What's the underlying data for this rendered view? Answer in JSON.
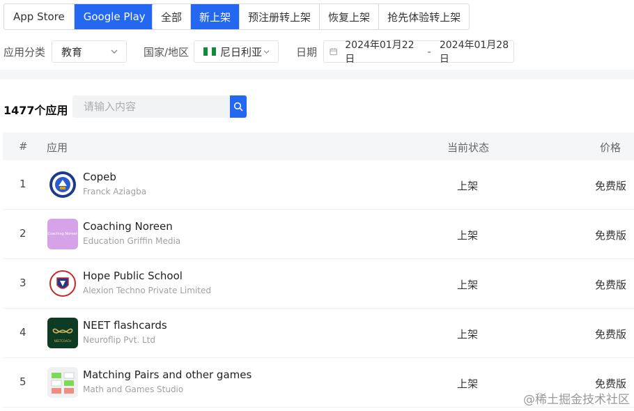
{
  "store_tabs": [
    {
      "label": "App Store",
      "active": false
    },
    {
      "label": "Google Play",
      "active": true
    }
  ],
  "type_tabs": [
    {
      "label": "全部",
      "active": false
    },
    {
      "label": "新上架",
      "active": true
    },
    {
      "label": "预注册转上架",
      "active": false
    },
    {
      "label": "恢复上架",
      "active": false
    },
    {
      "label": "抢先体验转上架",
      "active": false
    }
  ],
  "filters": {
    "category_label": "应用分类",
    "category_value": "教育",
    "country_label": "国家/地区",
    "country_value": "尼日利亚",
    "date_label": "日期",
    "date_start": "2024年01月22日",
    "date_sep": "-",
    "date_end": "2024年01月28日"
  },
  "summary": {
    "count": "1477个应用",
    "search_placeholder": "请输入内容"
  },
  "table": {
    "headers": {
      "index": "#",
      "app": "应用",
      "status": "当前状态",
      "price": "价格"
    },
    "rows": [
      {
        "index": "1",
        "name": "Copeb",
        "developer": "Franck Aziagba",
        "status": "上架",
        "price": "免费版",
        "icon": "copeb-badge-icon"
      },
      {
        "index": "2",
        "name": "Coaching Noreen",
        "developer": "Education Griffin Media",
        "status": "上架",
        "price": "免费版",
        "icon": "coaching-noreen-icon",
        "icon_text": "Coaching Noreen"
      },
      {
        "index": "3",
        "name": "Hope Public School",
        "developer": "Alexion Techno Private Limited",
        "status": "上架",
        "price": "免费版",
        "icon": "hope-school-crest-icon",
        "icon_text": "HOPE PUBLIC SCHOOL"
      },
      {
        "index": "4",
        "name": "NEET flashcards",
        "developer": "Neuroflip Pvt. Ltd",
        "status": "上架",
        "price": "免费版",
        "icon": "neet-infinity-icon",
        "icon_text": "NEETCOACH"
      },
      {
        "index": "5",
        "name": "Matching Pairs and other games",
        "developer": "Math and Games Studio",
        "status": "上架",
        "price": "免费版",
        "icon": "matching-pairs-icon"
      }
    ]
  },
  "watermark": "@稀土掘金技术社区",
  "colors": {
    "accent": "#2468f2",
    "header_bg": "#f5f6f8"
  }
}
